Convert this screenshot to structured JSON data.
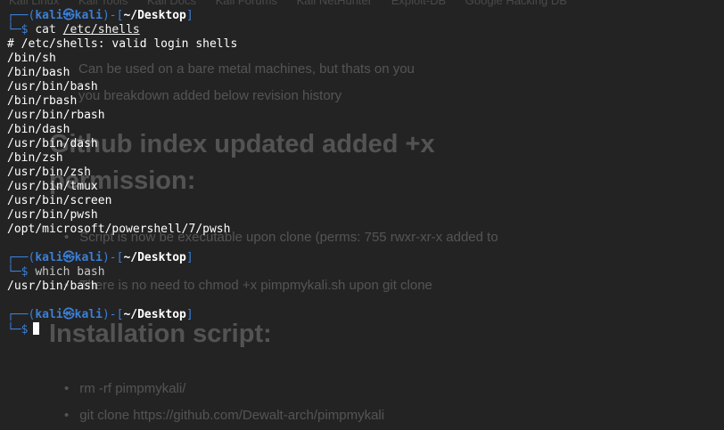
{
  "background": {
    "bookmarks": [
      "Kali Linux",
      "Kali Tools",
      "Kali Docs",
      "Kali Forums",
      "Kali NetHunter",
      "Exploit-DB",
      "Google Hacking DB"
    ],
    "line1": "Can be used on a bare metal machines, but thats on you",
    "line2": "you breakdown added below revision history",
    "heading1a": "Github index updated added +x",
    "heading1b": "permission:",
    "bullet1": "Script is now be executable upon clone (perms: 755 rwxr-xr-x added to",
    "bullet2": "There is no need to chmod +x pimpmykali.sh upon git clone",
    "heading2": "Installation script:",
    "bullet3": "rm -rf pimpmykali/",
    "bullet4": "git clone https://github.com/Dewalt-arch/pimpmykali"
  },
  "terminal": {
    "prompt": {
      "user": "kali",
      "at": "㉿",
      "host": "kali",
      "dir": "~/Desktop"
    },
    "cmd1": {
      "name": "cat",
      "arg": "/etc/shells"
    },
    "output1": [
      "# /etc/shells: valid login shells",
      "/bin/sh",
      "/bin/bash",
      "/usr/bin/bash",
      "/bin/rbash",
      "/usr/bin/rbash",
      "/bin/dash",
      "/usr/bin/dash",
      "/bin/zsh",
      "/usr/bin/zsh",
      "/usr/bin/tmux",
      "/usr/bin/screen",
      "/usr/bin/pwsh",
      "/opt/microsoft/powershell/7/pwsh"
    ],
    "cmd2": {
      "text": "which bash"
    },
    "output2": "/usr/bin/bash"
  }
}
